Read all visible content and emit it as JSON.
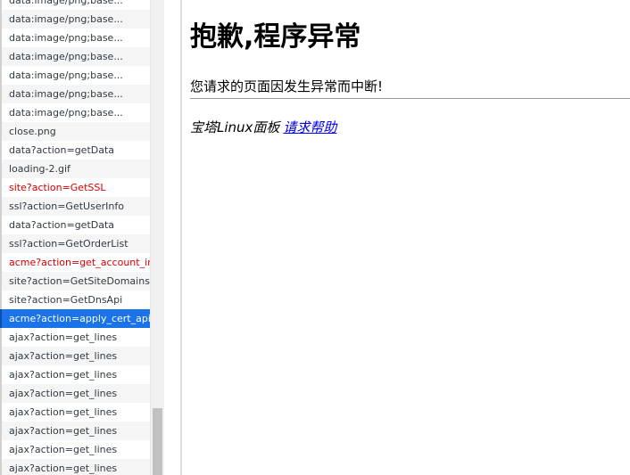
{
  "requests": [
    {
      "name": "data:image/png;base...",
      "status": "normal"
    },
    {
      "name": "data:image/png;base...",
      "status": "normal"
    },
    {
      "name": "data:image/png;base...",
      "status": "normal"
    },
    {
      "name": "data:image/png;base...",
      "status": "normal"
    },
    {
      "name": "data:image/png;base...",
      "status": "normal"
    },
    {
      "name": "data:image/png;base...",
      "status": "normal"
    },
    {
      "name": "data:image/png;base...",
      "status": "normal"
    },
    {
      "name": "close.png",
      "status": "normal"
    },
    {
      "name": "data?action=getData",
      "status": "normal"
    },
    {
      "name": "loading-2.gif",
      "status": "normal"
    },
    {
      "name": "site?action=GetSSL",
      "status": "error"
    },
    {
      "name": "ssl?action=GetUserInfo",
      "status": "normal"
    },
    {
      "name": "data?action=getData",
      "status": "normal"
    },
    {
      "name": "ssl?action=GetOrderList",
      "status": "normal"
    },
    {
      "name": "acme?action=get_account_info",
      "status": "error"
    },
    {
      "name": "site?action=GetSiteDomains",
      "status": "normal"
    },
    {
      "name": "site?action=GetDnsApi",
      "status": "normal"
    },
    {
      "name": "acme?action=apply_cert_api",
      "status": "selected"
    },
    {
      "name": "ajax?action=get_lines",
      "status": "normal"
    },
    {
      "name": "ajax?action=get_lines",
      "status": "normal"
    },
    {
      "name": "ajax?action=get_lines",
      "status": "normal"
    },
    {
      "name": "ajax?action=get_lines",
      "status": "normal"
    },
    {
      "name": "ajax?action=get_lines",
      "status": "normal"
    },
    {
      "name": "ajax?action=get_lines",
      "status": "normal"
    },
    {
      "name": "ajax?action=get_lines",
      "status": "normal"
    },
    {
      "name": "ajax?action=get_lines",
      "status": "normal"
    }
  ],
  "preview": {
    "title": "抱歉,程序异常",
    "message": "您请求的页面因发生异常而中断!",
    "footer_text": "宝塔Linux面板",
    "footer_link": "请求帮助"
  },
  "colors": {
    "selected_bg": "#1a73e8",
    "error_text": "#d60000",
    "link": "#0000ee"
  }
}
